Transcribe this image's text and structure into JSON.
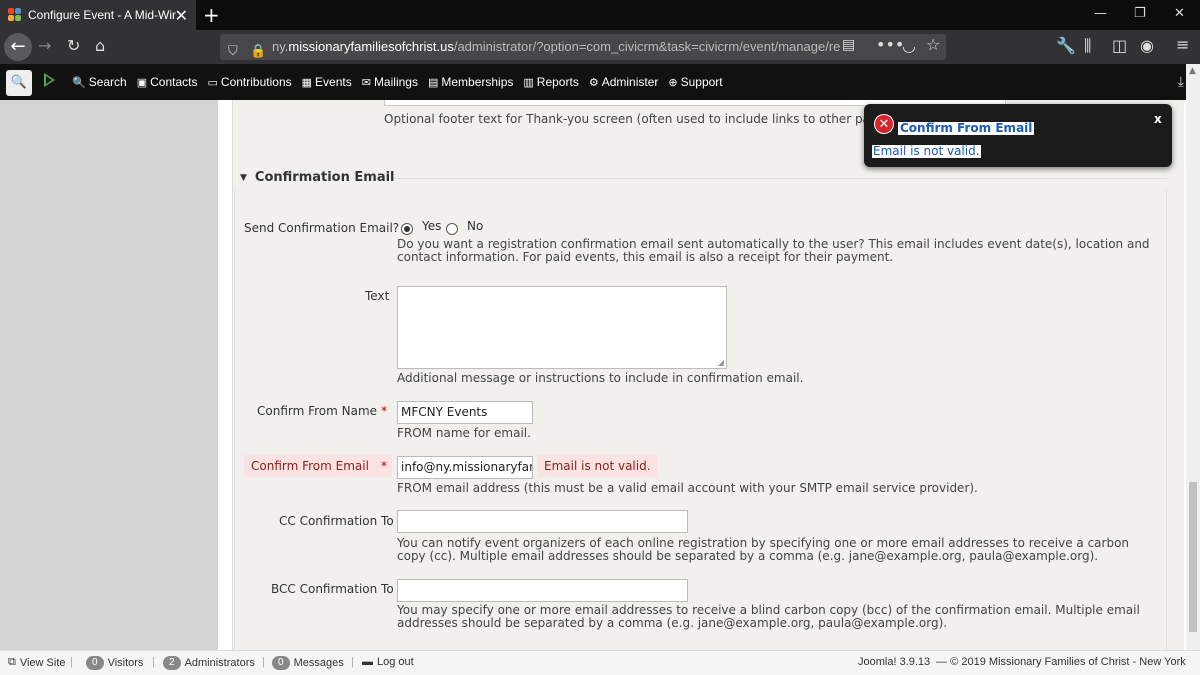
{
  "browser": {
    "tab_title": "Configure Event - A Mid-Winte",
    "url_prefix": "ny.",
    "url_domain": "missionaryfamiliesofchrist.us",
    "url_path": "/administrator/?option=com_civicrm&task=civicrm/event/manage/re"
  },
  "admin_menu": {
    "items": [
      {
        "icon": "search-icon",
        "label": "Search"
      },
      {
        "icon": "contacts-icon",
        "label": "Contacts"
      },
      {
        "icon": "contributions-icon",
        "label": "Contributions"
      },
      {
        "icon": "events-icon",
        "label": "Events"
      },
      {
        "icon": "mailings-icon",
        "label": "Mailings"
      },
      {
        "icon": "memberships-icon",
        "label": "Memberships"
      },
      {
        "icon": "reports-icon",
        "label": "Reports"
      },
      {
        "icon": "administer-icon",
        "label": "Administer"
      },
      {
        "icon": "support-icon",
        "label": "Support"
      }
    ]
  },
  "form": {
    "footer_help": "Optional footer text for Thank-you screen (often used to include links to other pages/activities on your site).",
    "section_title": "Confirmation Email",
    "send_confirmation": {
      "label": "Send Confirmation Email?",
      "yes": "Yes",
      "no": "No",
      "selected": "Yes",
      "help": "Do you want a registration confirmation email sent automatically to the user? This email includes event date(s), location and contact information. For paid events, this email is also a receipt for their payment."
    },
    "text": {
      "label": "Text",
      "value": "",
      "help": "Additional message or instructions to include in confirmation email."
    },
    "from_name": {
      "label": "Confirm From Name",
      "required": "*",
      "value": "MFCNY Events",
      "help": "FROM name for email."
    },
    "from_email": {
      "label": "Confirm From Email",
      "required": "*",
      "value": "info@ny.missionaryfamiliesofchrist.us",
      "error": "Email is not valid.",
      "help": "FROM email address (this must be a valid email account with your SMTP email service provider)."
    },
    "cc": {
      "label": "CC Confirmation To",
      "value": "",
      "help": "You can notify event organizers of each online registration by specifying one or more email addresses to receive a carbon copy (cc). Multiple email addresses should be separated by a comma (e.g. jane@example.org, paula@example.org)."
    },
    "bcc": {
      "label": "BCC Confirmation To",
      "value": "",
      "help": "You may specify one or more email addresses to receive a blind carbon copy (bcc) of the confirmation email. Multiple email addresses should be separated by a comma (e.g. jane@example.org, paula@example.org)."
    }
  },
  "notification": {
    "title": "Confirm From Email",
    "message": "Email is not valid.",
    "close": "x"
  },
  "statusbar": {
    "view_site": "View Site",
    "visitors_count": "0",
    "visitors_label": "Visitors",
    "admins_count": "2",
    "admins_label": "Administrators",
    "messages_count": "0",
    "messages_label": "Messages",
    "logout": "Log out",
    "version": "Joomla! 3.9.13",
    "copyright": "— © 2019 Missionary Families of Christ - New York"
  },
  "colors": {
    "error_bg": "#fbe3e4",
    "error_text": "#8a1f11",
    "admin_bar": "#111111",
    "link_blue": "#1a5bb8"
  }
}
